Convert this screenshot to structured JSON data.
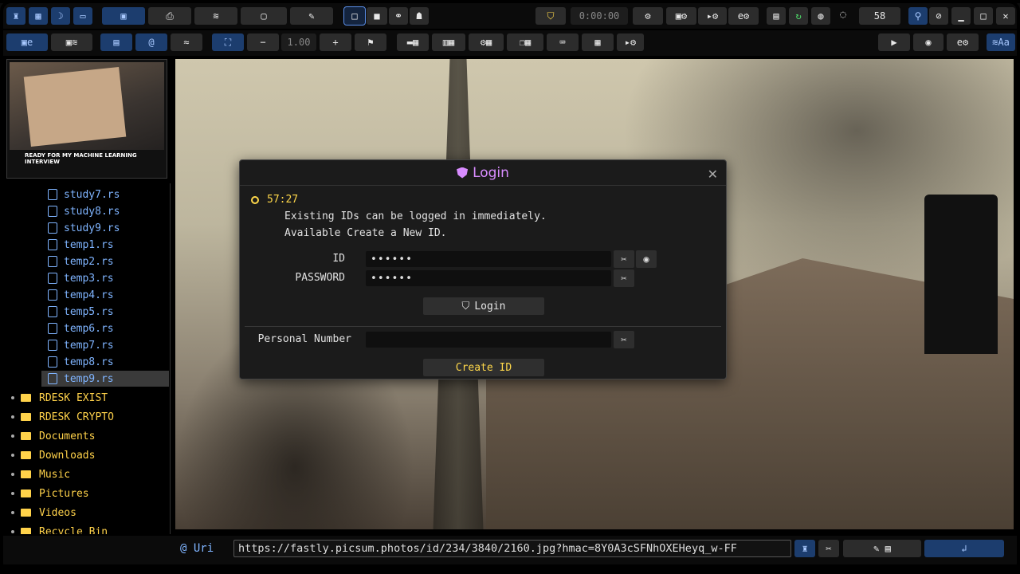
{
  "toolbar_top": {
    "timer_display": "0:00:00",
    "count": "58"
  },
  "toolbar_second": {
    "zoom_value": "1.00",
    "zoom_minus": "−",
    "zoom_plus": "+"
  },
  "thumbnail": {
    "caption": "READY FOR MY MACHINE LEARNING INTERVIEW"
  },
  "file_tree": {
    "files": [
      "study7.rs",
      "study8.rs",
      "study9.rs",
      "temp1.rs",
      "temp2.rs",
      "temp3.rs",
      "temp4.rs",
      "temp5.rs",
      "temp6.rs",
      "temp7.rs",
      "temp8.rs",
      "temp9.rs"
    ],
    "selected": "temp9.rs",
    "folders": [
      "RDESK EXIST",
      "RDESK CRYPTO",
      "Documents",
      "Downloads",
      "Music",
      "Pictures",
      "Videos",
      "Recycle Bin"
    ]
  },
  "dialog": {
    "title": "Login",
    "close": "✕",
    "timer": "57:27",
    "message_line1": "Existing IDs can be logged in immediately.",
    "message_line2": "Available Create a New ID.",
    "id_label": "ID",
    "id_value": "••••••",
    "password_label": "PASSWORD",
    "password_value": "••••••",
    "login_button": "Login",
    "personal_number_label": "Personal Number",
    "personal_number_value": "",
    "create_button": "Create ID"
  },
  "bottom_bar": {
    "uri_label": "@ Uri",
    "uri_value": "https://fastly.picsum.photos/id/234/3840/2160.jpg?hmac=8Y0A3cSFNhOXEHeyq_w-FF"
  },
  "colors": {
    "accent_blue": "#7fb4ff",
    "accent_yellow": "#ffd84a",
    "dialog_title": "#d88cff",
    "background": "#000000"
  }
}
